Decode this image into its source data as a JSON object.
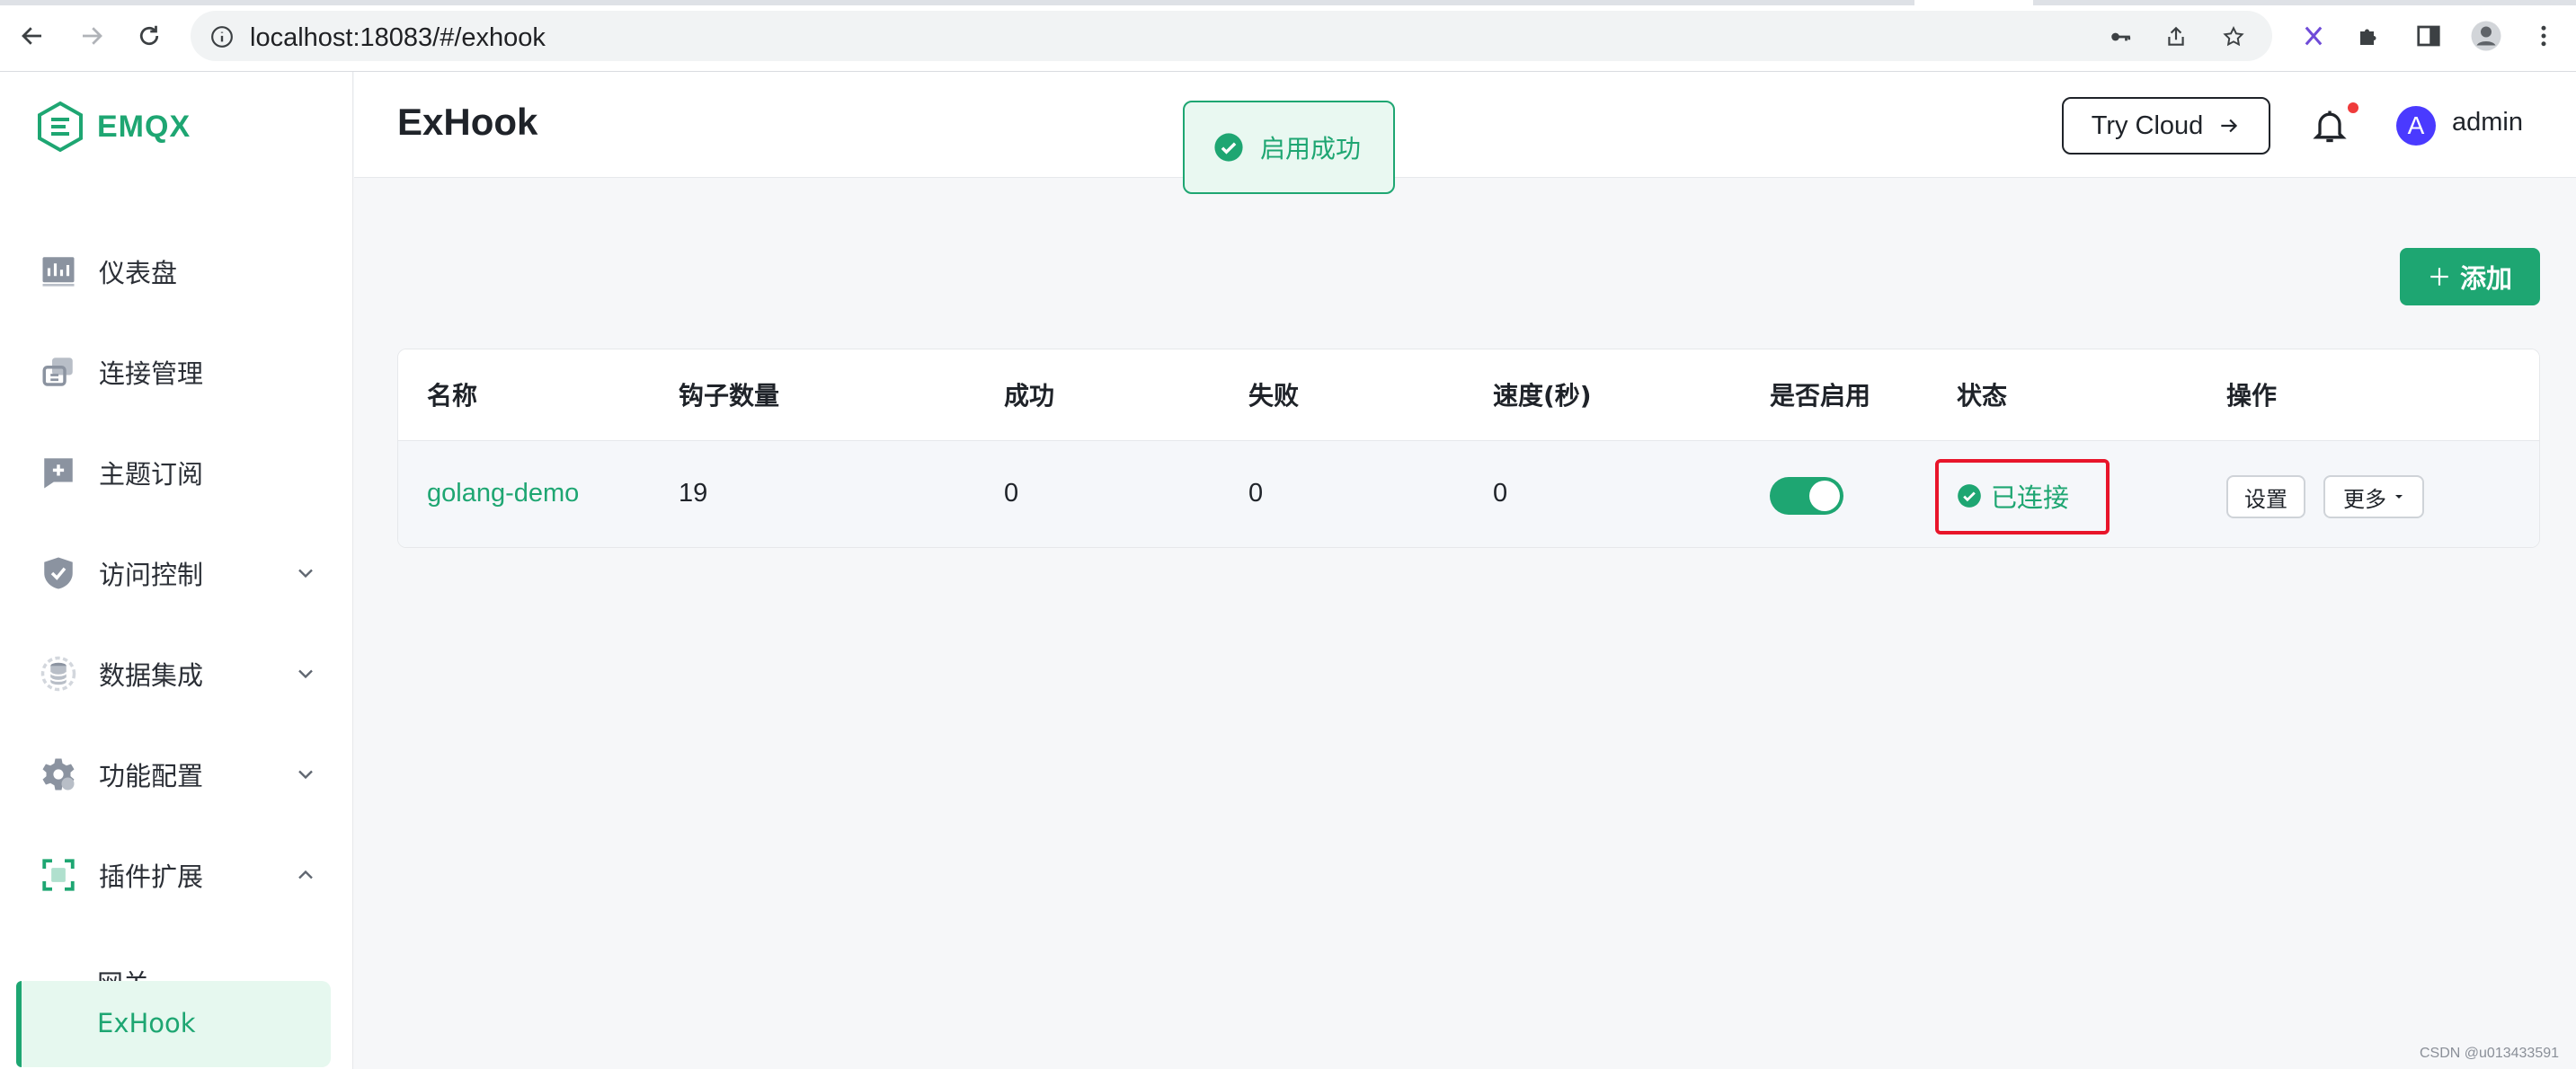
{
  "browser": {
    "url": "localhost:18083/#/exhook"
  },
  "sidebar": {
    "logo_text": "EMQX",
    "items": [
      {
        "label": "仪表盘",
        "icon": "dashboard-icon"
      },
      {
        "label": "连接管理",
        "icon": "connections-icon"
      },
      {
        "label": "主题订阅",
        "icon": "subscription-icon"
      },
      {
        "label": "访问控制",
        "icon": "shield-icon",
        "expandable": true
      },
      {
        "label": "数据集成",
        "icon": "database-icon",
        "expandable": true
      },
      {
        "label": "功能配置",
        "icon": "gear-icon",
        "expandable": true
      },
      {
        "label": "插件扩展",
        "icon": "extension-icon",
        "expanded": true
      }
    ],
    "subitems": [
      {
        "label": "网关"
      },
      {
        "label": "ExHook",
        "active": true
      }
    ]
  },
  "header": {
    "title": "ExHook",
    "try_cloud_label": "Try Cloud",
    "user_initial": "A",
    "user_name": "admin"
  },
  "toast": {
    "message": "启用成功"
  },
  "toolbar": {
    "add_label": "添加"
  },
  "table": {
    "columns": [
      "名称",
      "钩子数量",
      "成功",
      "失败",
      "速度(秒)",
      "是否启用",
      "状态",
      "操作"
    ],
    "rows": [
      {
        "name": "golang-demo",
        "hooks": "19",
        "success": "0",
        "failed": "0",
        "rate": "0",
        "enabled": true,
        "status": "已连接",
        "settings_label": "设置",
        "more_label": "更多"
      }
    ]
  },
  "watermark": "CSDN @u013433591",
  "colors": {
    "brand": "#1ea672",
    "highlight": "#e8152a",
    "avatar": "#4a3aff"
  }
}
